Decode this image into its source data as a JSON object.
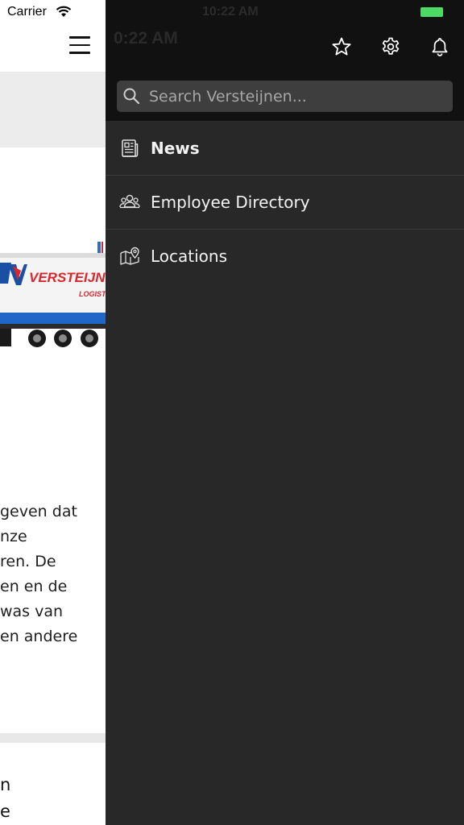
{
  "status_bar": {
    "carrier": "Carrier",
    "time": "10:22 AM",
    "ghost_time": "0:22 AM"
  },
  "colors": {
    "drawer_bg": "#282828",
    "header_bg": "#111111",
    "search_bg": "#3e3e3e",
    "battery": "#4cd964",
    "brand_blue": "#1a4fa6",
    "brand_red": "#d9272e"
  },
  "background_page": {
    "body_lines": [
      "geven dat",
      "nze",
      "ren. De",
      "en en de",
      "was van",
      "en andere"
    ],
    "bottom_lines": [
      "n",
      "e"
    ],
    "truck_brand": "VERSTEIJNE",
    "truck_sub": "LOGISTI"
  },
  "drawer": {
    "header_icons": [
      "star-icon",
      "gear-icon",
      "bell-icon"
    ],
    "search": {
      "placeholder": "Search Versteijnen..."
    },
    "nav": [
      {
        "label": "News",
        "icon": "newspaper-icon",
        "active": true
      },
      {
        "label": "Employee Directory",
        "icon": "people-icon",
        "active": false
      },
      {
        "label": "Locations",
        "icon": "map-pin-icon",
        "active": false
      }
    ]
  }
}
